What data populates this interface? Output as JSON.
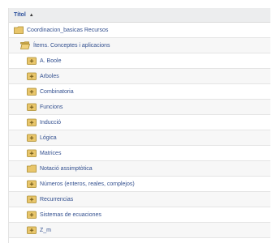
{
  "table": {
    "header": {
      "label": "Títol",
      "sort_indicator": "▲"
    },
    "rows": [
      {
        "label": "Coordinacion_basicas Recursos",
        "icon": "folder-icon"
      },
      {
        "label": "Ítems. Conceptes i aplicacions",
        "icon": "folder-open-icon"
      },
      {
        "label": "A. Boole",
        "icon": "folder-plus-icon"
      },
      {
        "label": "Arboles",
        "icon": "folder-plus-icon"
      },
      {
        "label": "Combinatoria",
        "icon": "folder-plus-icon"
      },
      {
        "label": "Funcions",
        "icon": "folder-plus-icon"
      },
      {
        "label": "Inducció",
        "icon": "folder-plus-icon"
      },
      {
        "label": "Lógica",
        "icon": "folder-plus-icon"
      },
      {
        "label": "Matrices",
        "icon": "folder-plus-icon"
      },
      {
        "label": "Notació assimptòtica",
        "icon": "folder-icon"
      },
      {
        "label": "Números (enteros, reales, complejos)",
        "icon": "folder-plus-icon"
      },
      {
        "label": "Recurrencias",
        "icon": "folder-plus-icon"
      },
      {
        "label": "Sistemas de ecuaciones",
        "icon": "folder-plus-icon"
      },
      {
        "label": "Z_m",
        "icon": "folder-plus-icon"
      }
    ]
  },
  "colors": {
    "folder_fill": "#e9c66b",
    "folder_border": "#a98a2e",
    "link_text": "#33508f"
  }
}
